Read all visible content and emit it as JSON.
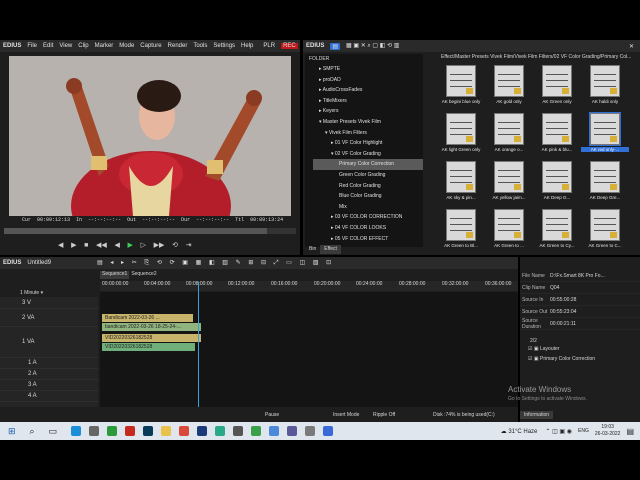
{
  "player": {
    "menu": [
      "EDIUS",
      "File",
      "Edit",
      "View",
      "Clip",
      "Marker",
      "Mode",
      "Capture",
      "Render",
      "Tools",
      "Settings",
      "Help"
    ],
    "plr": "PLR",
    "rec": "REC",
    "cur_label": "Cur",
    "cur": "00:09:12:13",
    "in_label": "In",
    "in": "--:--:--:--",
    "out_label": "Out",
    "out": "--:--:--:--",
    "dur_label": "Dur",
    "dur": "--:--:--:--",
    "ttl_label": "Ttl",
    "ttl": "00:09:13:24"
  },
  "bin": {
    "title": "EDIUS",
    "folder_label": "FOLDER",
    "path": "Effect/Master Presets Vivek Film/Vivek Film Filters/02 VF Color Grading/Primary Col...",
    "tree": [
      "SMPTE",
      "proDAD",
      "AudioCrossFades",
      "TitleMixers",
      "Keyers",
      "Master Presets Vivek Film",
      "Vivek Film Filters",
      "01 VF Color Highlight",
      "02 VF Color Grading",
      "Primary Color Correction",
      "Green Color Grading",
      "Red Color Grading",
      "Blue Color Grading",
      "Mix",
      "03 VF COLOR CORRECTION",
      "04 VF COLOR LOOKS",
      "05 VF COLOR EFFECT"
    ],
    "tab_bin": "Bin",
    "tab_effect": "Effect",
    "effects": [
      "AK begini blue only",
      "AK gold only",
      "AK Green only",
      "AK haldi only",
      "AK light Green only",
      "AK orange o...",
      "AK pink & blu...",
      "AK red only-...",
      "AK sky & pin...",
      "AK yellow jaim...",
      "AK Deep G...",
      "AK Deep Gre...",
      "AK Green to Bl...",
      "AK Green to ...",
      "AK Green to Cy...",
      "AK Green to C..."
    ]
  },
  "timeline": {
    "title": "EDIUS",
    "project": "Untitled9",
    "tabs": [
      "Sequence1",
      "Sequence2"
    ],
    "scale": "1 Minute",
    "ruler": [
      "00:00:00:00",
      "00:04:00:00",
      "00:08:00:00",
      "00:12:00:00",
      "00:16:00:00",
      "00:20:00:00",
      "00:24:00:00",
      "00:28:00:00",
      "00:32:00:00",
      "00:36:00:00"
    ],
    "tracks": [
      "3 V",
      "2 VA",
      "1 VA",
      "1 A",
      "2 A",
      "3 A",
      "4 A"
    ],
    "clips": [
      "Bandicam 2022-03-26 ...",
      "bandicam 2022-03-26 18-25-24-...",
      "VID20220326182528",
      "VID20220326182528"
    ],
    "status": [
      "Pause",
      "Insert Mode",
      "Ripple Off",
      "Disk :74% is being used(C:)"
    ]
  },
  "info": {
    "rows": [
      {
        "k": "File Name",
        "v": "D:\\Fx.Smart 8K Pro Fo..."
      },
      {
        "k": "Clip Name",
        "v": "Q04"
      },
      {
        "k": "Source In",
        "v": "00:55:00:28"
      },
      {
        "k": "Source Out",
        "v": "00:55:23:04"
      },
      {
        "k": "Source Duration",
        "v": "00:00:21:11"
      }
    ],
    "count": "2/2",
    "filters": [
      "Layouter",
      "Primary Color Correction"
    ],
    "tab": "Information",
    "watermark1": "Activate Windows",
    "watermark2": "Go to Settings to activate Windows."
  },
  "taskbar": {
    "temp": "31°C Haze",
    "lang": "ENG",
    "time": "19:03",
    "date": "26-03-2022"
  }
}
